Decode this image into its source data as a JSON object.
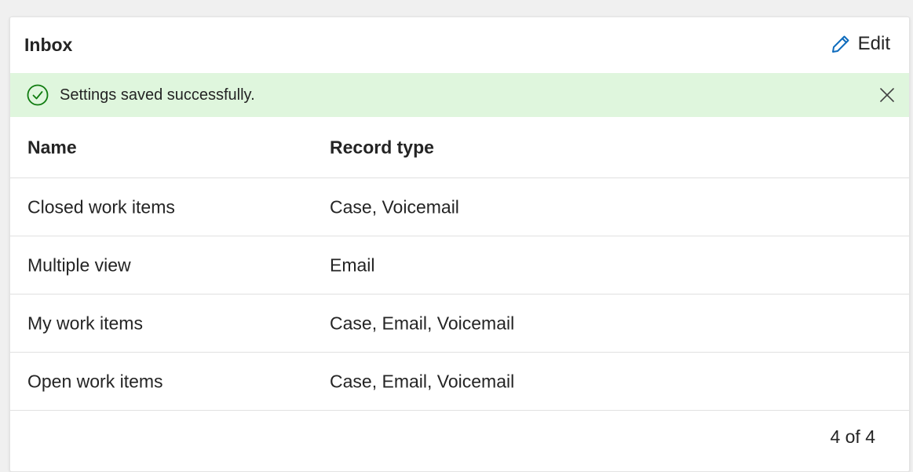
{
  "panel": {
    "title": "Inbox",
    "edit_label": "Edit"
  },
  "banner": {
    "message": "Settings saved successfully.",
    "status_color": "#107c10",
    "background": "#dff6dd"
  },
  "table": {
    "columns": [
      "Name",
      "Record type"
    ],
    "rows": [
      {
        "name": "Closed work items",
        "record_type": "Case, Voicemail"
      },
      {
        "name": "Multiple view",
        "record_type": "Email"
      },
      {
        "name": "My work items",
        "record_type": "Case, Email, Voicemail"
      },
      {
        "name": "Open work items",
        "record_type": "Case, Email, Voicemail"
      }
    ]
  },
  "footer": {
    "count": "4 of 4"
  },
  "icons": {
    "edit": "pencil-icon",
    "success": "checkmark-circle-icon",
    "dismiss": "close-icon"
  },
  "colors": {
    "accent": "#0f6cbd"
  }
}
